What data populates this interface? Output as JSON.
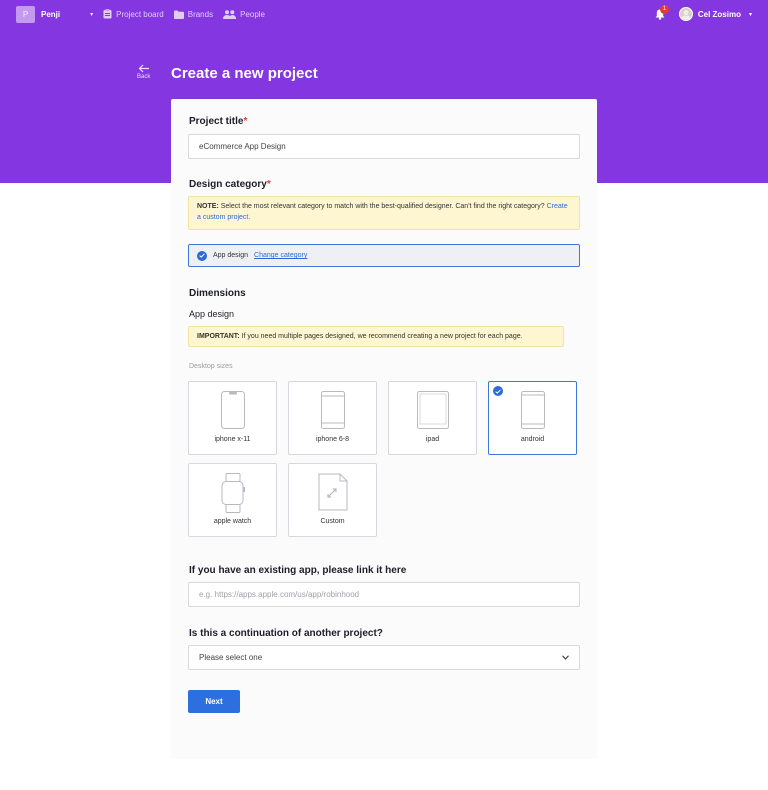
{
  "nav": {
    "brand_initial": "P",
    "brand_name": "Penji",
    "items": [
      {
        "label": "Project board",
        "icon": "clipboard-icon"
      },
      {
        "label": "Brands",
        "icon": "folder-icon"
      },
      {
        "label": "People",
        "icon": "people-icon"
      }
    ],
    "notification_count": "1",
    "user_name": "Cel Zosimo"
  },
  "header": {
    "back_label": "Back",
    "title": "Create a new project"
  },
  "form": {
    "project_title": {
      "label": "Project title",
      "required_mark": "*",
      "value": "eCommerce App Design"
    },
    "design_category": {
      "label": "Design category",
      "required_mark": "*",
      "note_prefix": "NOTE:",
      "note_text": " Select the most relevant category to match with the best-qualified designer. Can't find the right category? ",
      "note_link": "Create a custom project.",
      "selected": "App design",
      "change_label": "Change category"
    },
    "dimensions": {
      "label": "Dimensions",
      "sub_label": "App design",
      "important_prefix": "IMPORTANT:",
      "important_text": " If you need multiple pages designed, we recommend creating a new project for each page.",
      "sizes_label": "Desktop sizes",
      "tiles": [
        {
          "label": "iphone x-11",
          "icon": "iphone-x-icon",
          "selected": false
        },
        {
          "label": "iphone 6-8",
          "icon": "iphone-6-icon",
          "selected": false
        },
        {
          "label": "ipad",
          "icon": "ipad-icon",
          "selected": false
        },
        {
          "label": "android",
          "icon": "android-phone-icon",
          "selected": true
        },
        {
          "label": "apple watch",
          "icon": "apple-watch-icon",
          "selected": false
        },
        {
          "label": "Custom",
          "icon": "custom-file-icon",
          "selected": false
        }
      ]
    },
    "existing_app": {
      "label": "If you have an existing app, please link it here",
      "placeholder": "e.g. https://apps.apple.com/us/app/robinhood"
    },
    "continuation": {
      "label": "Is this a continuation of another project?",
      "selected": "Please select one"
    },
    "next_label": "Next"
  },
  "colors": {
    "brand_purple": "#8436e0",
    "primary_blue": "#2e6fe0",
    "required_red": "#e53935",
    "note_yellow": "#fdf6d1"
  }
}
